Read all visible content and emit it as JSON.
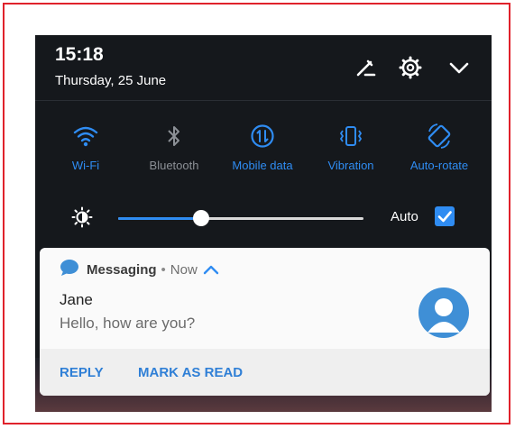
{
  "status": {
    "time": "15:18",
    "date": "Thursday, 25 June"
  },
  "header_icons": [
    "edit-icon",
    "settings-gear-icon",
    "chevron-down-icon"
  ],
  "quick_toggles": [
    {
      "label": "Wi-Fi",
      "icon": "wifi-icon",
      "state": "on"
    },
    {
      "label": "Bluetooth",
      "icon": "bluetooth-icon",
      "state": "off"
    },
    {
      "label": "Mobile data",
      "icon": "mobile-data-icon",
      "state": "on"
    },
    {
      "label": "Vibration",
      "icon": "vibration-icon",
      "state": "on"
    },
    {
      "label": "Auto-rotate",
      "icon": "auto-rotate-icon",
      "state": "on"
    }
  ],
  "brightness": {
    "level": 0.34,
    "auto_label": "Auto",
    "auto_checked": true
  },
  "notification": {
    "app": "Messaging",
    "separator": "•",
    "when": "Now",
    "sender": "Jane",
    "message": "Hello, how are you?",
    "actions": {
      "reply": "REPLY",
      "mark_read": "MARK AS READ"
    }
  },
  "colors": {
    "accent": "#2f8cf2",
    "inactive": "#8c9096",
    "panel": "#15181c",
    "frame": "#e0222b"
  }
}
